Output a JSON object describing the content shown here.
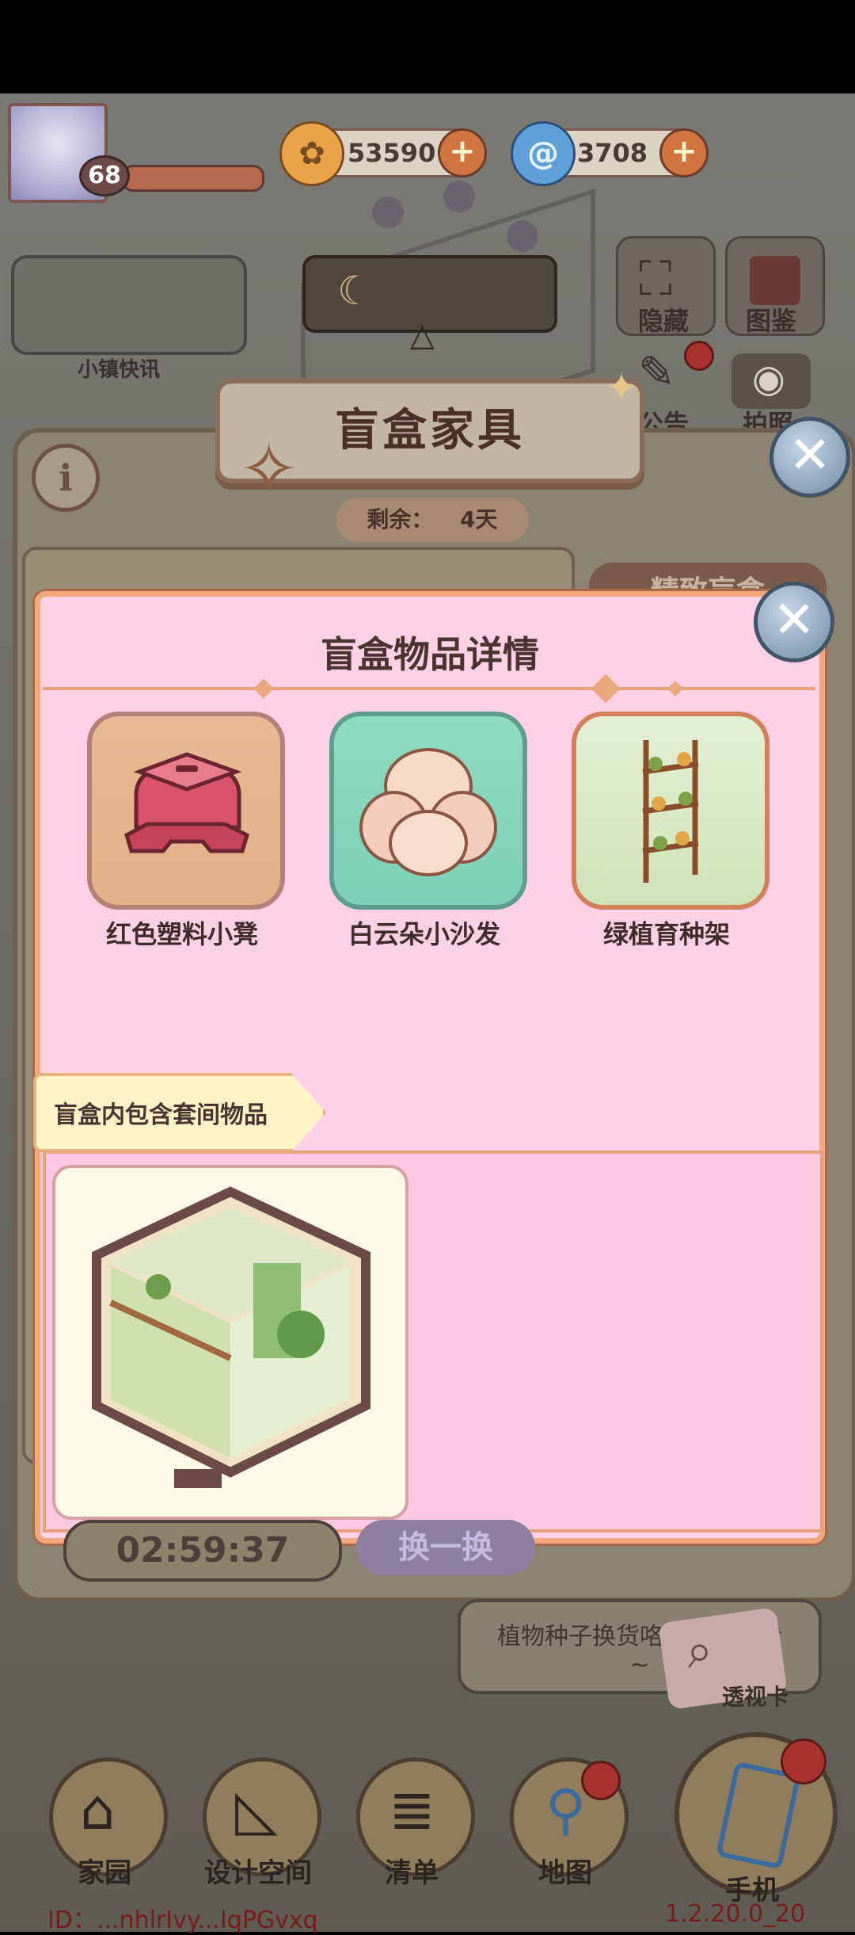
{
  "hud": {
    "level": "68",
    "coins": "53590",
    "gems": "3708",
    "plus_glyph": "+"
  },
  "top_buttons": {
    "news_label": "小镇快讯",
    "hide_label": "隐藏",
    "catalog_label": "图鉴",
    "notice_label": "公告",
    "photo_label": "拍照"
  },
  "panel": {
    "title": "盲盒家具",
    "info_glyph": "i",
    "remaining_label": "剩余：",
    "remaining_value": "4天",
    "side_tab": "精致盲盒",
    "close_glyph": "✕"
  },
  "dialog": {
    "title": "盲盒物品详情",
    "close_glyph": "✕",
    "items": [
      {
        "name": "红色塑料小凳"
      },
      {
        "name": "白云朵小沙发"
      },
      {
        "name": "绿植育种架"
      }
    ],
    "set_section_label": "盲盒内包含套间物品"
  },
  "bottom": {
    "timer": "02:59:37",
    "swap_label": "换一换",
    "tip_line1": "植物种子换货咯～快来看看",
    "tip_line2": "~",
    "peek_card_label": "透视卡"
  },
  "nav": [
    {
      "label": "家园"
    },
    {
      "label": "设计空间"
    },
    {
      "label": "清单"
    },
    {
      "label": "地图"
    },
    {
      "label": "手机"
    }
  ],
  "footer": {
    "id_text": "ID：...nhlrIvy...IqPGvxq",
    "version": "1.2.20.0_20"
  },
  "colors": {
    "dialog_bg": "#ffd1e6",
    "dialog_border": "#f2a77c",
    "title_text": "#4a3330",
    "accent_orange": "#d17540"
  }
}
